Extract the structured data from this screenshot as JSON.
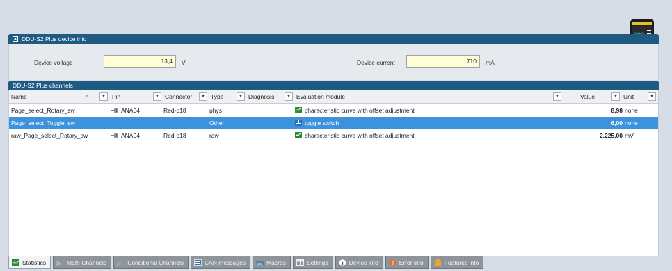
{
  "device_info": {
    "header": "DDU-S2 Plus device info",
    "voltage_label": "Device voltage",
    "voltage_value": "13,4",
    "voltage_unit": "V",
    "current_label": "Device current",
    "current_value": "710",
    "current_unit": "mA"
  },
  "channels": {
    "header": "DDU-S2 Plus channels",
    "columns": {
      "name": "Name",
      "pin": "Pin",
      "connector": "Connector",
      "type": "Type",
      "diagnosis": "Diagnosis",
      "evaluation": "Evaluation module",
      "value": "Value",
      "unit": "Unit"
    },
    "rows": [
      {
        "name": "Page_select_Rotary_sw",
        "pin": "ANA04",
        "connector": "Red-p18",
        "type": "phys",
        "diagnosis": "",
        "evaluation": "characteristic curve with offset adjustment",
        "value": "8,98",
        "unit": "none"
      },
      {
        "name": "Page_select_Toggle_sw",
        "pin": "",
        "connector": "",
        "type": "Other",
        "diagnosis": "",
        "evaluation": "toggle switch",
        "value": "6,00",
        "unit": "none"
      },
      {
        "name": "raw_Page_select_Rotary_sw",
        "pin": "ANA04",
        "connector": "Red-p18",
        "type": "raw",
        "diagnosis": "",
        "evaluation": "characteristic curve with offset adjustment",
        "value": "2.225,00",
        "unit": "mV"
      }
    ]
  },
  "tabs": [
    {
      "label": "Statistics",
      "icon": "chart-icon"
    },
    {
      "label": "Math Channels",
      "icon": "formula-icon"
    },
    {
      "label": "Conditional Channels",
      "icon": "formula-icon"
    },
    {
      "label": "CAN messages",
      "icon": "can-icon"
    },
    {
      "label": "Macros",
      "icon": "macro-icon"
    },
    {
      "label": "Settings",
      "icon": "settings-icon"
    },
    {
      "label": "Device info",
      "icon": "info-icon"
    },
    {
      "label": "Error info",
      "icon": "error-icon"
    },
    {
      "label": "Features info",
      "icon": "features-icon"
    }
  ],
  "colors": {
    "header": "#1e5a82",
    "selection": "#3d92dd",
    "input_bg": "#fffdd4"
  }
}
